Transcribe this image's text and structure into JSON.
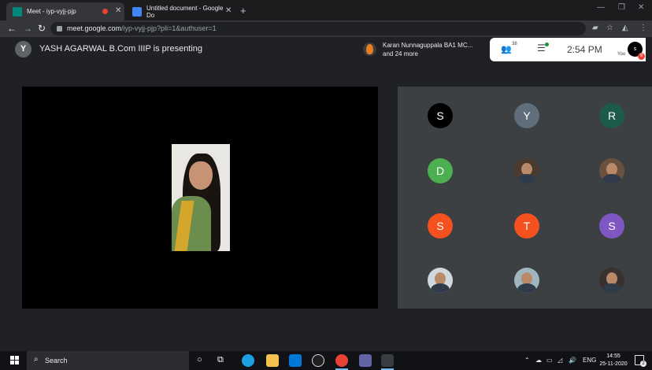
{
  "browser": {
    "tabs": [
      {
        "title": "Meet - iyp-vyjj-pjp",
        "favicon_color": "#00897b",
        "recording": true,
        "active": true
      },
      {
        "title": "Untitled document - Google Do",
        "favicon_color": "#4285f4",
        "active": false
      }
    ],
    "new_tab_glyph": "+",
    "address": {
      "host": "meet.google.com",
      "path": "/iyp-vyjj-pjp?pli=1&authuser=1"
    }
  },
  "meet": {
    "presenter_initial": "Y",
    "presenting_text": "YASH AGARWAL B.Com IIIP is presenting",
    "chat_preview": {
      "name": "Karan Nunnaguppala BA1 MC...",
      "more": "and 24 more"
    },
    "people_count": "38",
    "time": "2:54 PM",
    "self": {
      "label": "You",
      "initial": "s",
      "badge": "9"
    },
    "participants": [
      {
        "initial": "S",
        "color": "#000000",
        "kind": "letter"
      },
      {
        "initial": "Y",
        "color": "#5f6e7a",
        "kind": "letter"
      },
      {
        "initial": "R",
        "color": "#1e5a4a",
        "kind": "letter"
      },
      {
        "initial": "D",
        "color": "#4caf50",
        "kind": "letter"
      },
      {
        "initial": "",
        "color": "#4a3b2e",
        "kind": "photo"
      },
      {
        "initial": "",
        "color": "#6b5040",
        "kind": "photo"
      },
      {
        "initial": "S",
        "color": "#f4511e",
        "kind": "letter"
      },
      {
        "initial": "T",
        "color": "#f4511e",
        "kind": "letter"
      },
      {
        "initial": "S",
        "color": "#7e57c2",
        "kind": "letter"
      },
      {
        "initial": "",
        "color": "#cfd8dc",
        "kind": "photo"
      },
      {
        "initial": "",
        "color": "#9fb5c0",
        "kind": "photo"
      },
      {
        "initial": "",
        "color": "#3a3030",
        "kind": "photo"
      }
    ]
  },
  "taskbar": {
    "search_placeholder": "Search",
    "language": "ENG",
    "clock_time": "14:55",
    "clock_date": "25-11-2020",
    "notification_count": "2"
  },
  "colors": {
    "meet_bg": "#202124",
    "grid_bg": "#3c4043",
    "accent_red": "#ea4335"
  }
}
